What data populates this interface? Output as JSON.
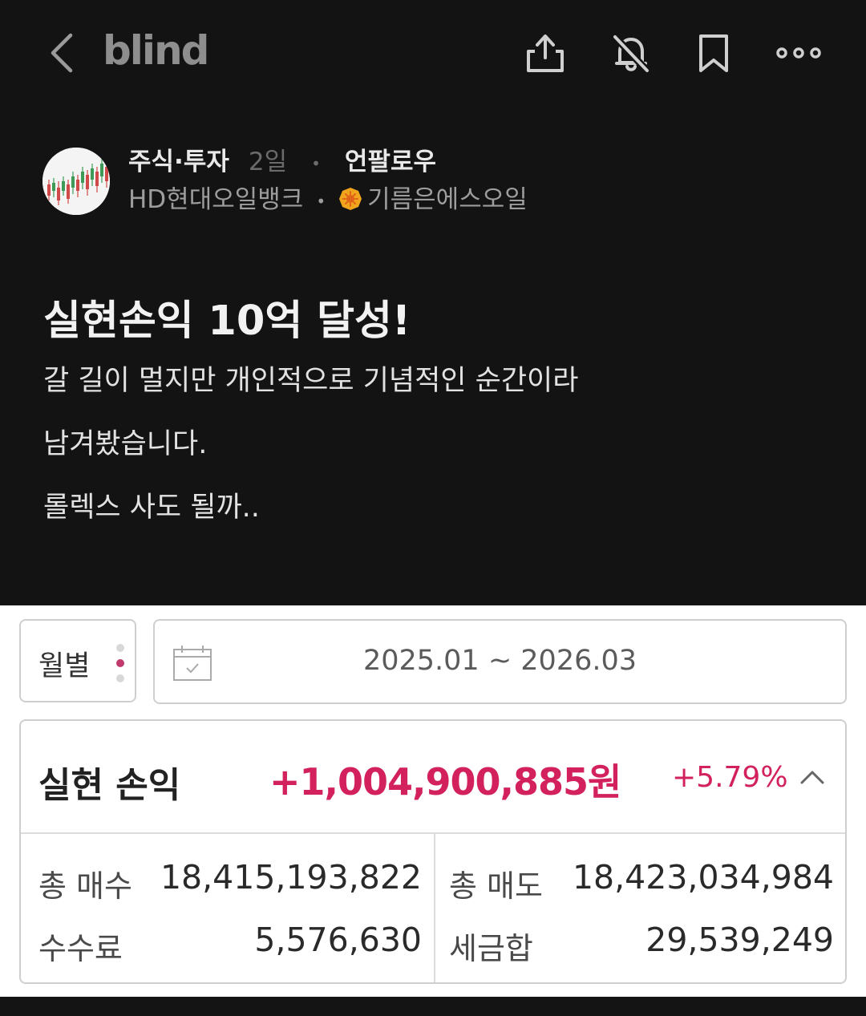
{
  "app": {
    "logo": "blind"
  },
  "post": {
    "board": "주식·투자",
    "time_ago": "2일",
    "follow_label": "언팔로우",
    "company": "HD현대오일뱅크",
    "author": "기름은에스오일",
    "title": "실현손익 10억 달성!",
    "body_lines": [
      "갈 길이 멀지만 개인적으로 기념적인 순간이라",
      "남겨봤습니다.",
      "롤렉스 사도 될까.."
    ]
  },
  "screenshot": {
    "period_select": "월별",
    "date_range": "2025.01 ~ 2026.03",
    "realized": {
      "label": "실현 손익",
      "value": "+1,004,900,885원",
      "rate": "+5.79%"
    },
    "grid": {
      "total_buy_label": "총 매수",
      "total_buy": "18,415,193,822",
      "total_sell_label": "총 매도",
      "total_sell": "18,423,034,984",
      "fee_label": "수수료",
      "fee": "5,576,630",
      "tax_label": "세금합",
      "tax": "29,539,249"
    }
  },
  "colors": {
    "background": "#131313",
    "profit": "#d2215d",
    "badge": "#f1a51c"
  },
  "icons": [
    "back-icon",
    "share-icon",
    "bell-off-icon",
    "bookmark-icon",
    "more-icon",
    "calendar-icon",
    "chevron-up-icon"
  ]
}
